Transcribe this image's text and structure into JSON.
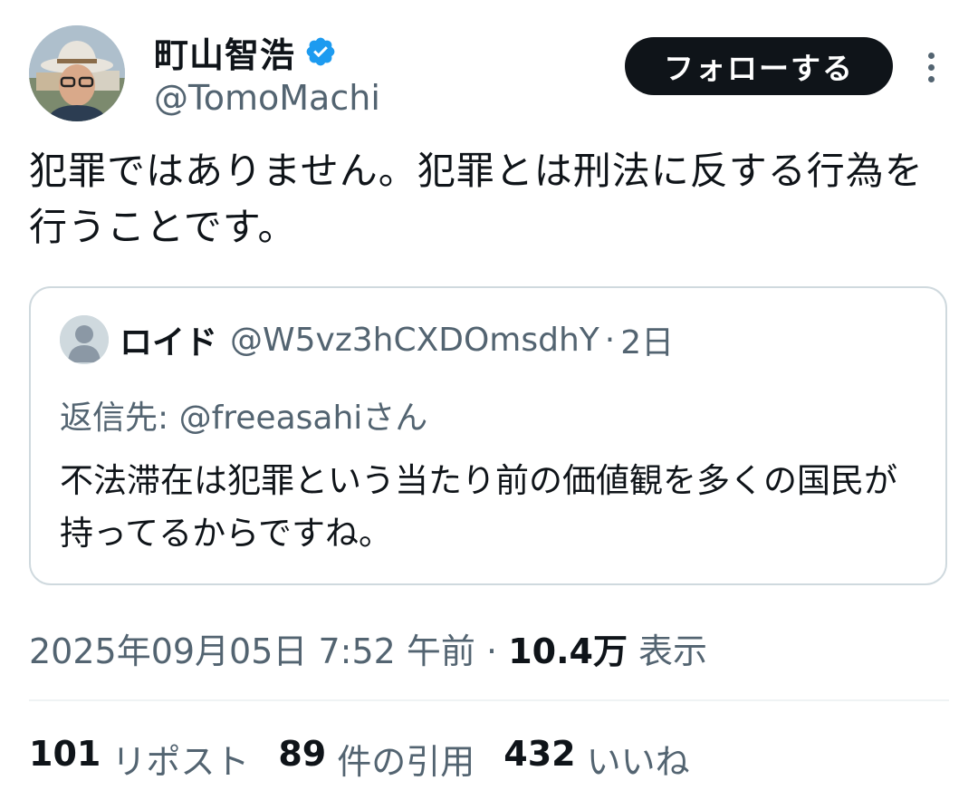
{
  "tweet": {
    "author": {
      "name": "町山智浩",
      "handle": "@TomoMachi",
      "verified_color": "#1d9bf0"
    },
    "follow_label": "フォローする",
    "text": "犯罪ではありません。犯罪とは刑法に反する行為を行うことです。",
    "timestamp": "2025年09月05日 7:52 午前",
    "separator": "·",
    "views_count": "10.4万",
    "views_label": "表示",
    "stats": {
      "reposts": {
        "count": "101",
        "label": "リポスト"
      },
      "quotes": {
        "count": "89",
        "label": "件の引用"
      },
      "likes": {
        "count": "432",
        "label": "いいね"
      }
    }
  },
  "quote": {
    "name": "ロイド",
    "handle": "@W5vz3hCXDOmsdhY",
    "separator": "·",
    "time": "2日",
    "reply_prefix": "返信先:",
    "reply_to": "@freeasahiさん",
    "text": "不法滞在は犯罪という当たり前の価値観を多くの国民が持ってるからですね。"
  },
  "colors": {
    "text": "#0f1419",
    "secondary": "#536471",
    "border": "#cfd9de",
    "accent": "#1d9bf0",
    "button_bg": "#0f1419"
  },
  "icons": [
    "verified-badge-icon",
    "more-options-icon",
    "default-avatar-icon"
  ]
}
